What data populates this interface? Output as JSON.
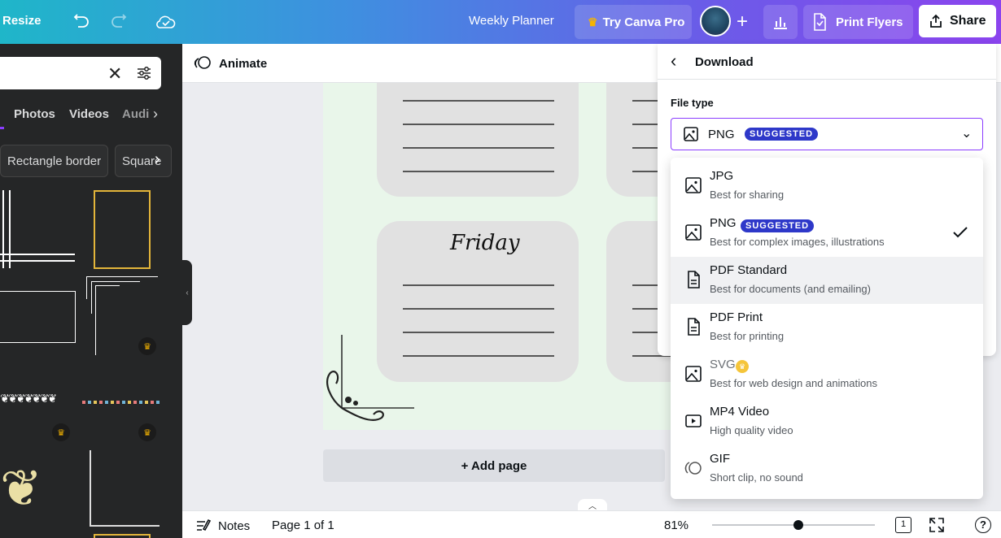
{
  "topbar": {
    "resize_label": "Resize",
    "title": "Weekly Planner",
    "try_pro_label": "Try Canva Pro",
    "print_label": "Print Flyers",
    "share_label": "Share"
  },
  "left_panel": {
    "tabs": [
      "Photos",
      "Videos",
      "Audi"
    ],
    "chips": [
      "Rectangle border",
      "Square"
    ]
  },
  "toolbar": {
    "animate_label": "Animate"
  },
  "canvas": {
    "day_label": "Friday",
    "add_page_label": "+ Add page"
  },
  "footer": {
    "notes_label": "Notes",
    "page_indicator": "Page 1 of 1",
    "zoom": "81%",
    "zoom_level": 0.81,
    "page_count": "1"
  },
  "download": {
    "title": "Download",
    "file_type_label": "File type",
    "selected": "PNG",
    "selected_badge": "SUGGESTED",
    "options": [
      {
        "name": "JPG",
        "desc": "Best for sharing",
        "icon": "image-icon"
      },
      {
        "name": "PNG",
        "desc": "Best for complex images, illustrations",
        "badge": "SUGGESTED",
        "icon": "image-icon",
        "checked": true
      },
      {
        "name": "PDF Standard",
        "desc": "Best for documents (and emailing)",
        "icon": "document-icon"
      },
      {
        "name": "PDF Print",
        "desc": "Best for printing",
        "icon": "document-icon"
      },
      {
        "name": "SVG",
        "desc": "Best for web design and animations",
        "icon": "image-icon",
        "pro": true
      },
      {
        "name": "MP4 Video",
        "desc": "High quality video",
        "icon": "video-icon"
      },
      {
        "name": "GIF",
        "desc": "Short clip, no sound",
        "icon": "gif-icon"
      }
    ]
  },
  "colors": {
    "accent": "#8b3dff",
    "badge": "#2e38c9",
    "sidebar": "#252627",
    "page_bg": "#e9f6ea",
    "card_bg": "#e1e1e1"
  }
}
